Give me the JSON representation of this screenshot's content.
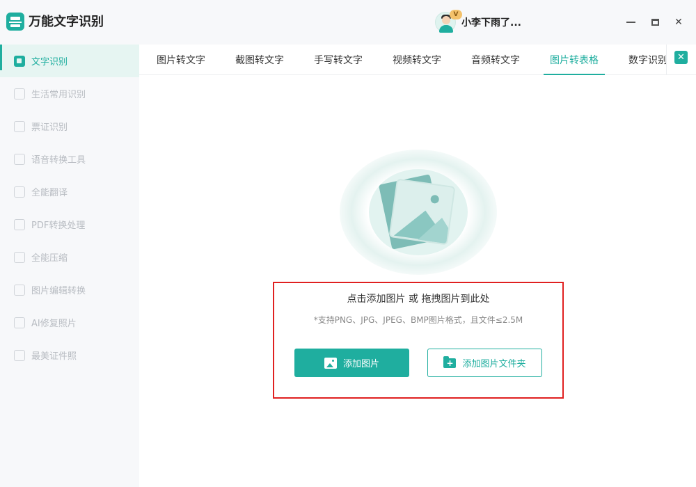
{
  "app": {
    "title": "万能文字识别",
    "user_name": "小李下雨了...",
    "vip_badge": "V"
  },
  "window_controls": {
    "minimize": "minimize",
    "maximize": "maximize",
    "close": "✕"
  },
  "sidebar": {
    "items": [
      {
        "label": "文字识别",
        "active": true
      },
      {
        "label": "生活常用识别",
        "active": false
      },
      {
        "label": "票证识别",
        "active": false
      },
      {
        "label": "语音转换工具",
        "active": false
      },
      {
        "label": "全能翻译",
        "active": false
      },
      {
        "label": "PDF转换处理",
        "active": false
      },
      {
        "label": "全能压缩",
        "active": false
      },
      {
        "label": "图片编辑转换",
        "active": false
      },
      {
        "label": "AI修复照片",
        "active": false
      },
      {
        "label": "最美证件照",
        "active": false
      }
    ]
  },
  "tabs": {
    "items": [
      {
        "label": "图片转文字",
        "active": false
      },
      {
        "label": "截图转文字",
        "active": false
      },
      {
        "label": "手写转文字",
        "active": false
      },
      {
        "label": "视频转文字",
        "active": false
      },
      {
        "label": "音频转文字",
        "active": false
      },
      {
        "label": "图片转表格",
        "active": true
      },
      {
        "label": "数字识别",
        "active": false
      }
    ],
    "close_icon": "✕"
  },
  "upload": {
    "title": "点击添加图片 或 拖拽图片到此处",
    "hint": "*支持PNG、JPG、JPEG、BMP图片格式，且文件≤2.5M",
    "add_image_label": "添加图片",
    "add_folder_label": "添加图片文件夹",
    "folder_plus": "+"
  },
  "colors": {
    "accent": "#1fae9f",
    "highlight_border": "#e02020",
    "sidebar_bg": "#f7f8fa"
  }
}
